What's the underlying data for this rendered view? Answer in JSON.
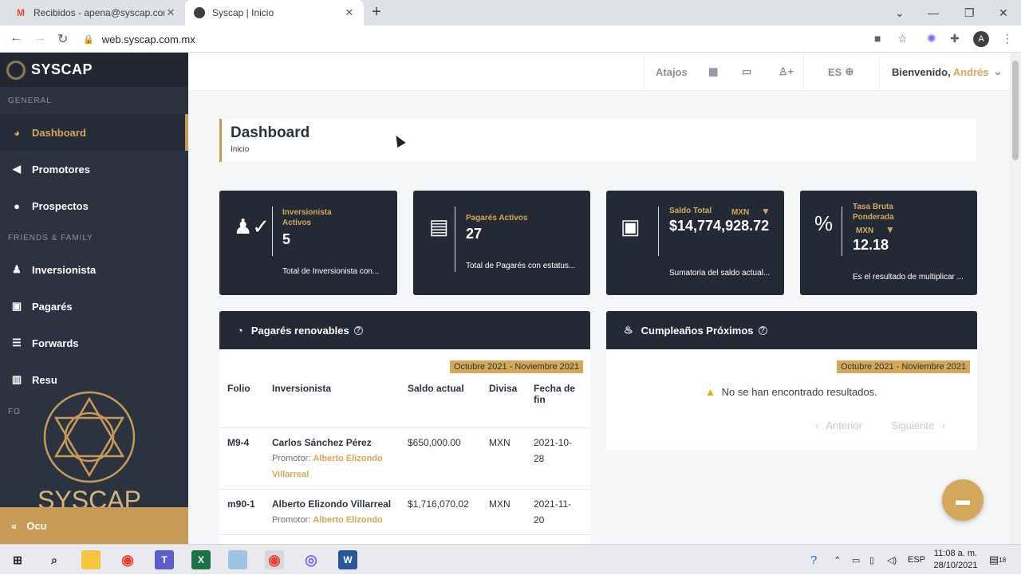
{
  "browser": {
    "tabs": [
      {
        "title": "Recibidos - apena@syscap.com.mx",
        "icon": "gmail-icon"
      },
      {
        "title": "Syscap | Inicio",
        "icon": "syscap-favicon-icon"
      }
    ],
    "url": "web.syscap.com.mx",
    "profile_initial": "A"
  },
  "sidebar": {
    "brand": "SYSCAP",
    "sections": {
      "general": "GENERAL",
      "friends": "FRIENDS & FAMILY",
      "other": "FO"
    },
    "items": [
      {
        "label": "Dashboard",
        "icon": "gauge-icon"
      },
      {
        "label": "Promotores",
        "icon": "megaphone-icon"
      },
      {
        "label": "Prospectos",
        "icon": "users-icon"
      },
      {
        "label": "Inversionista",
        "icon": "user-icon"
      },
      {
        "label": "Pagarés",
        "icon": "money-bill-icon"
      },
      {
        "label": "Forwards",
        "icon": "list-card-icon"
      },
      {
        "label": "Resu",
        "icon": "chart-icon"
      }
    ],
    "collapse_label": "Ocu",
    "watermark_text": "SYSCAP"
  },
  "topbar": {
    "shortcuts": "Atajos",
    "language": "ES",
    "welcome": "Bienvenido,",
    "user_name": "Andrés"
  },
  "page": {
    "title": "Dashboard",
    "breadcrumb": "Inicio"
  },
  "cards": [
    {
      "label": "Inversionista Activos",
      "value": "5",
      "desc": "Total de Inversionista con..."
    },
    {
      "label": "Pagarés Activos",
      "value": "27",
      "desc": "Total de Pagarés con estatus..."
    },
    {
      "label": "Saldo Total",
      "currency": "MXN",
      "value": "$14,774,928.72",
      "desc": "Sumatoria del saldo actual..."
    },
    {
      "label": "Tasa Bruta Ponderada",
      "currency": "MXN",
      "value": "12.18",
      "desc": "Es el resultado de multiplicar ..."
    }
  ],
  "renewables": {
    "title": "Pagarés renovables",
    "date_range": "Octubre 2021 - Noviembre 2021",
    "columns": [
      "Folio",
      "Inversionista",
      "Saldo actual",
      "Divisa",
      "Fecha de fin"
    ],
    "promoter_prefix": "Promotor:",
    "rows": [
      {
        "folio": "M9-4",
        "investor": "Carlos Sánchez Pérez",
        "promoter": "Alberto Elizondo Villarreal",
        "balance": "$650,000.00",
        "currency": "MXN",
        "end_date": "2021-10-28"
      },
      {
        "folio": "m90-1",
        "investor": "Alberto Elizondo Villarreal",
        "promoter": "Alberto Elizondo",
        "balance": "$1,716,070.02",
        "currency": "MXN",
        "end_date": "2021-11-20"
      }
    ]
  },
  "birthdays": {
    "title": "Cumpleaños Próximos",
    "date_range": "Octubre 2021 - Noviembre 2021",
    "empty": "No se han encontrado resultados.",
    "prev": "Anterior",
    "next": "Siguiente"
  },
  "taskbar": {
    "language": "ESP",
    "time": "11:08 a. m.",
    "date": "28/10/2021",
    "notifications": "18"
  }
}
